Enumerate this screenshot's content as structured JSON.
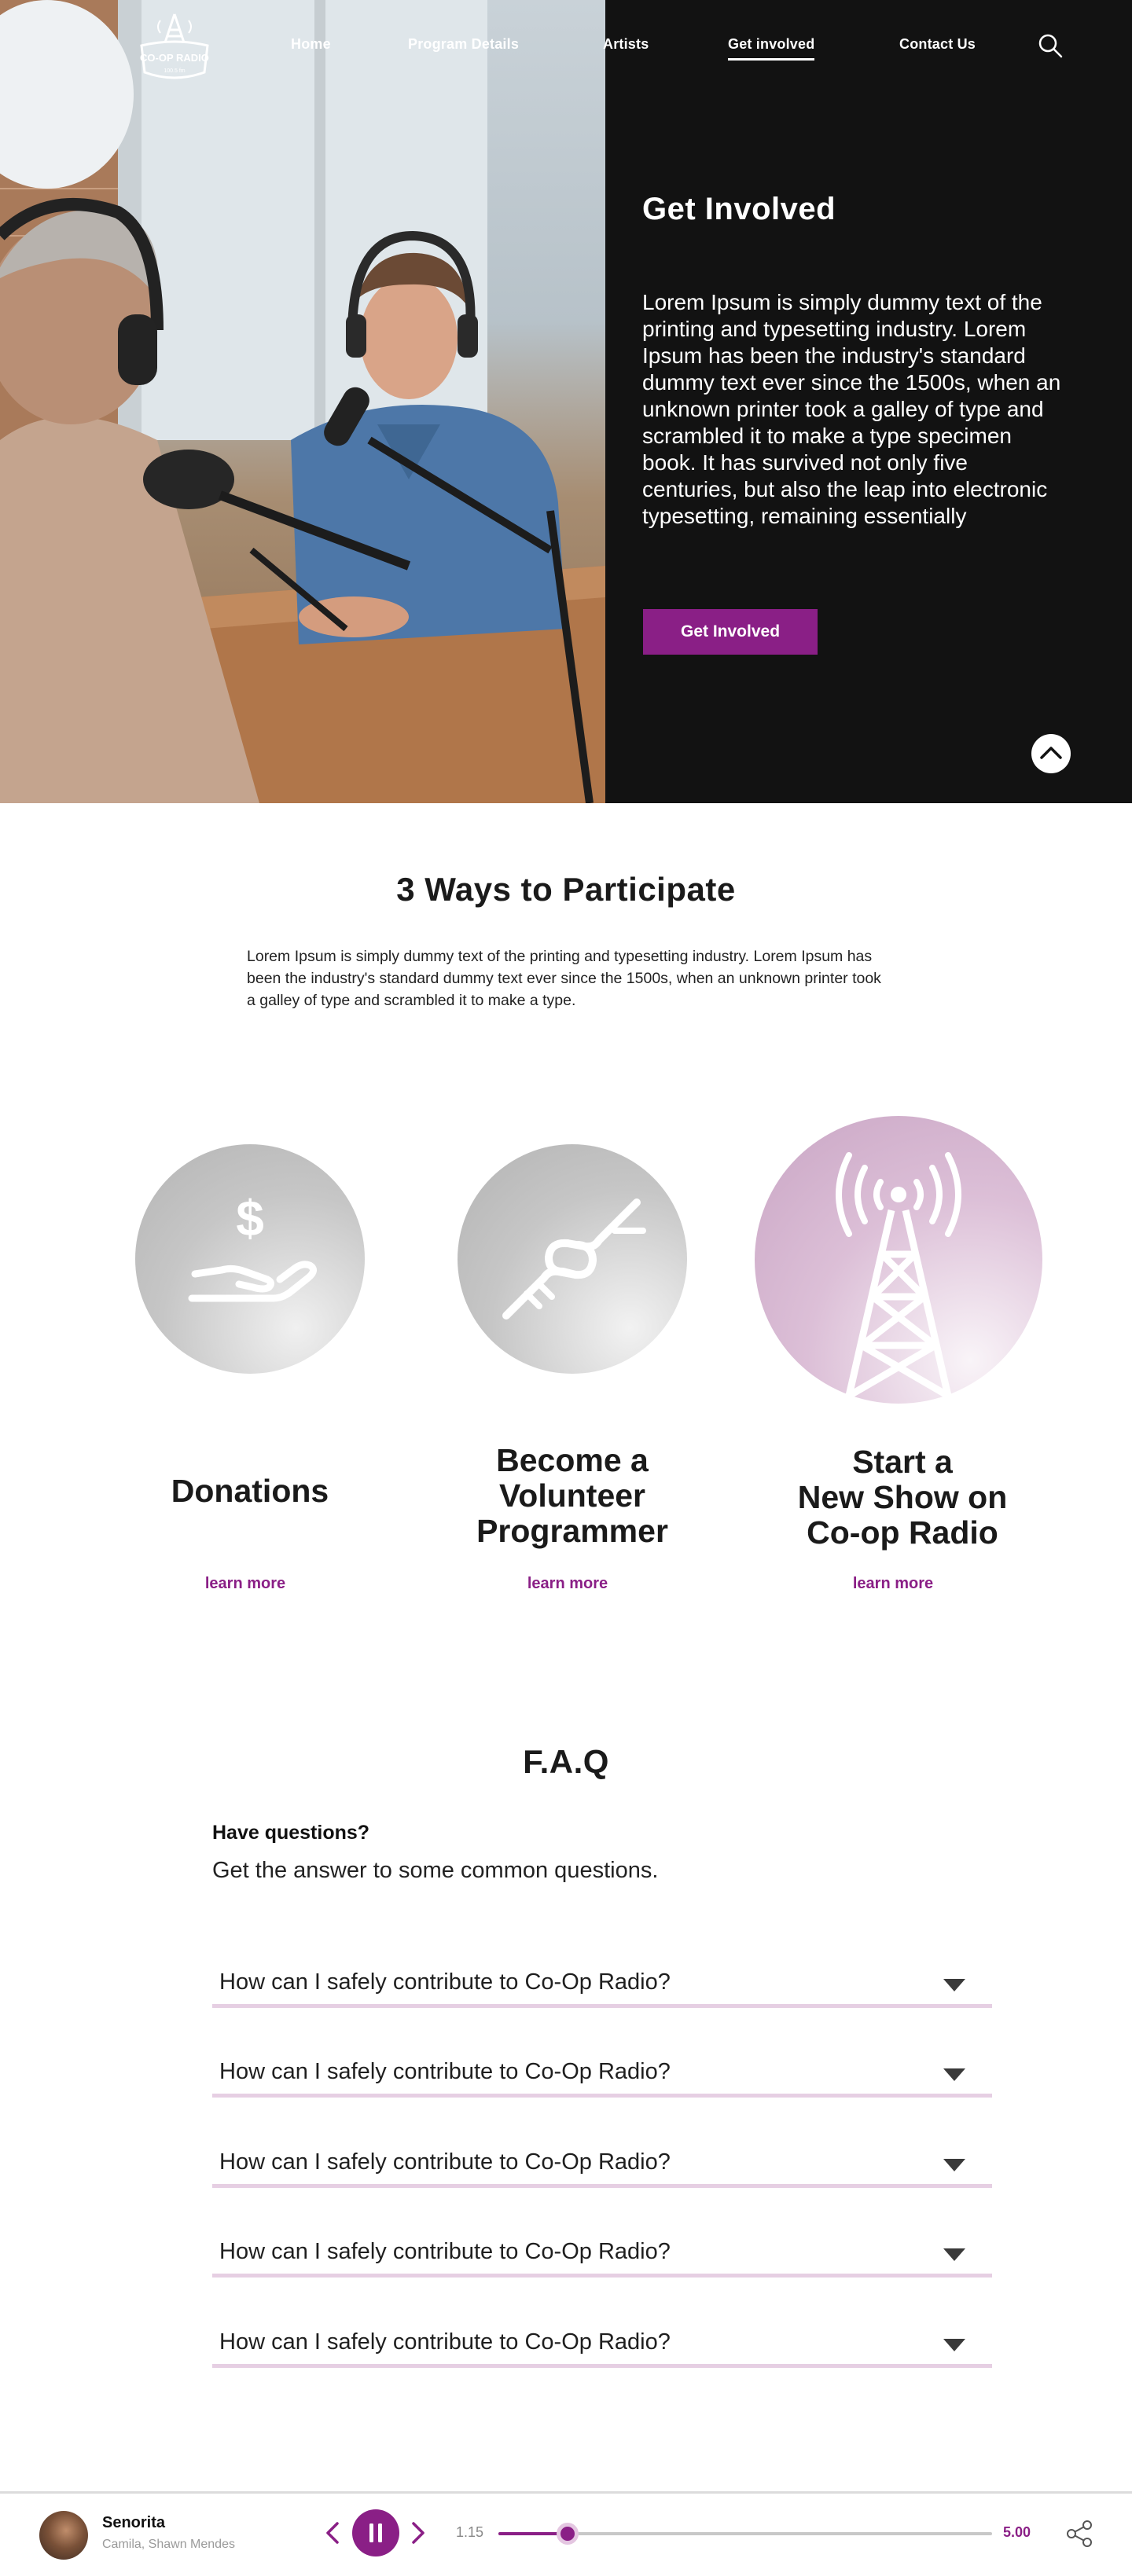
{
  "brand": {
    "logo_text": "CO-OP RADIO",
    "logo_subtext": "100.5 fm",
    "accent_color": "#8a1f86",
    "dark_color": "#121212",
    "divider_color": "#e6cfe3"
  },
  "nav": {
    "items": [
      {
        "label": "Home"
      },
      {
        "label": "Program Details"
      },
      {
        "label": "Artists"
      },
      {
        "label": "Get involved",
        "active": true
      },
      {
        "label": "Contact Us"
      }
    ],
    "search_icon": "search-icon"
  },
  "hero": {
    "title": "Get Involved",
    "body": "Lorem Ipsum is simply dummy text of the printing and typesetting industry. Lorem Ipsum has been the industry's standard dummy text ever since the 1500s, when an unknown printer took a galley of type and scrambled it to make a type specimen book. It has survived not only five centuries, but also the leap into electronic typesetting, remaining essentially",
    "cta_label": "Get Involved",
    "scroll_top_icon": "chevron-up-icon"
  },
  "ways": {
    "title": "3 Ways to Participate",
    "intro": "Lorem Ipsum is simply dummy text of the printing and typesetting industry. Lorem Ipsum has been the industry's standard dummy text ever since the 1500s, when an unknown printer took a galley of type and scrambled it to make a type.",
    "items": [
      {
        "title": "Donations",
        "link": "learn more",
        "icon": "donation-hand-icon"
      },
      {
        "title": "Become a Volunteer Programmer",
        "title_lines": [
          "Become a",
          "Volunteer",
          "Programmer"
        ],
        "link": "learn more",
        "icon": "handshake-icon"
      },
      {
        "title": "Start a New Show on Co-op Radio",
        "title_lines": [
          "Start a",
          "New Show on",
          "Co-op Radio"
        ],
        "link": "learn more",
        "icon": "radio-tower-icon"
      }
    ]
  },
  "faq": {
    "title": "F.A.Q",
    "subtitle": "Have questions?",
    "description": "Get the answer to some common questions.",
    "items": [
      {
        "question": "How can I safely contribute to Co-Op Radio?"
      },
      {
        "question": "How can I safely contribute to Co-Op Radio?"
      },
      {
        "question": "How can I safely contribute to Co-Op Radio?"
      },
      {
        "question": "How can I safely contribute to Co-Op Radio?"
      },
      {
        "question": "How can I safely contribute to Co-Op Radio?"
      }
    ]
  },
  "player": {
    "track_title": "Senorita",
    "track_artist": "Camila, Shawn Mendes",
    "current_time": "1.15",
    "total_time": "5.00",
    "progress_fraction": 0.14,
    "state": "playing"
  }
}
